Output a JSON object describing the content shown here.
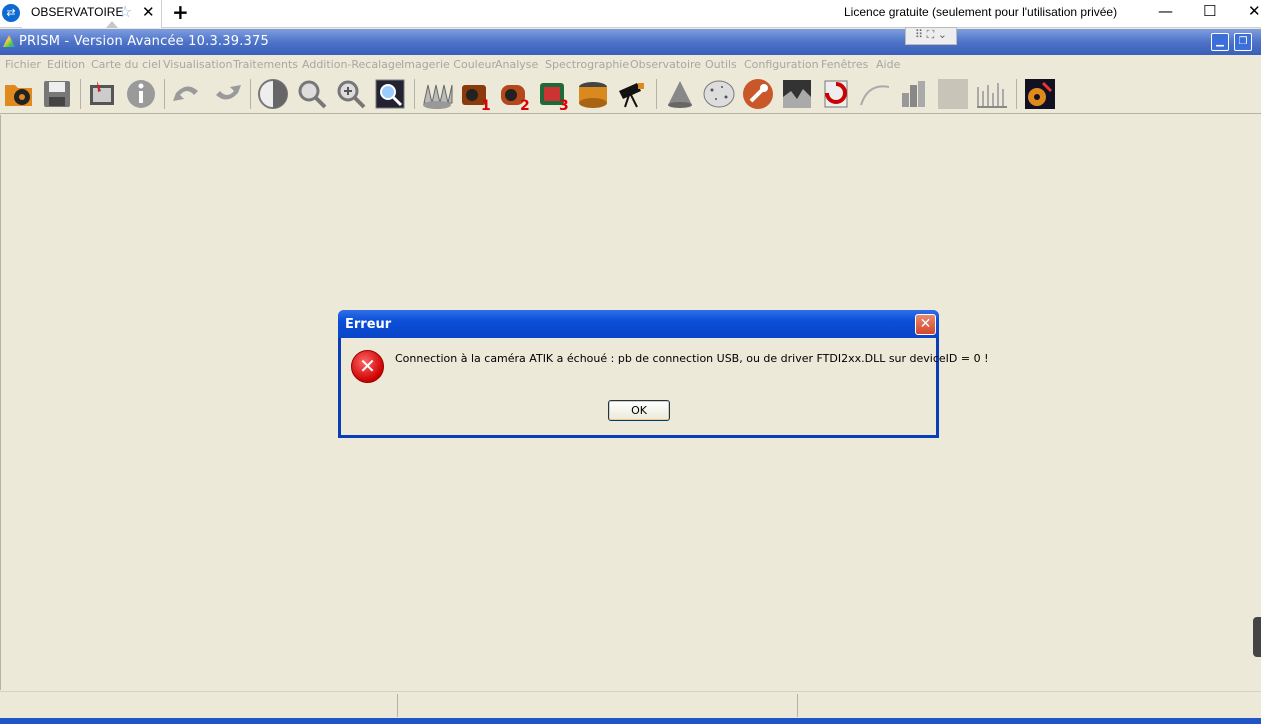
{
  "remote_bar": {
    "tab_label": "OBSERVATOIRE",
    "licence_text": "Licence gratuite (seulement pour l'utilisation privée)"
  },
  "app": {
    "title": "PRISM - Version Avancée  10.3.39.375"
  },
  "menu": {
    "items": [
      "Fichier",
      "Edition",
      "Carte du ciel",
      "Visualisation",
      "Traitements",
      "Addition-Recalage",
      "Imagerie Couleur",
      "Analyse",
      "Spectrographie",
      "Observatoire",
      "Outils",
      "Configuration",
      "Fenêtres",
      "Aide"
    ]
  },
  "toolbar": {
    "icons": [
      "open-folder-icon",
      "save-icon",
      "edit-image-icon",
      "info-icon",
      "undo-icon",
      "redo-icon",
      "contrast-icon",
      "zoom-out-icon",
      "zoom-in-icon",
      "zoom-fit-icon",
      "sawtooth-icon",
      "camera-1-icon",
      "camera-2-icon",
      "camera-3-icon",
      "filter-wheel-icon",
      "telescope-icon",
      "cone-icon",
      "starfield-icon",
      "wrench-icon",
      "image-crop-icon",
      "rotate-icon",
      "curve-icon",
      "histogram-icon",
      "blank-icon",
      "spectrum-icon",
      "gear-settings-icon"
    ]
  },
  "dialog": {
    "title": "Erreur",
    "message": "Connection à la caméra ATIK a échoué : pb de connection USB, ou de driver FTDI2xx.DLL sur deviceID = 0 !",
    "ok_label": "OK"
  },
  "colors": {
    "title_bar": "#4e73c8",
    "dialog_title": "#0b4ed8",
    "workspace": "#ece9d8",
    "error_red": "#cc0000"
  }
}
